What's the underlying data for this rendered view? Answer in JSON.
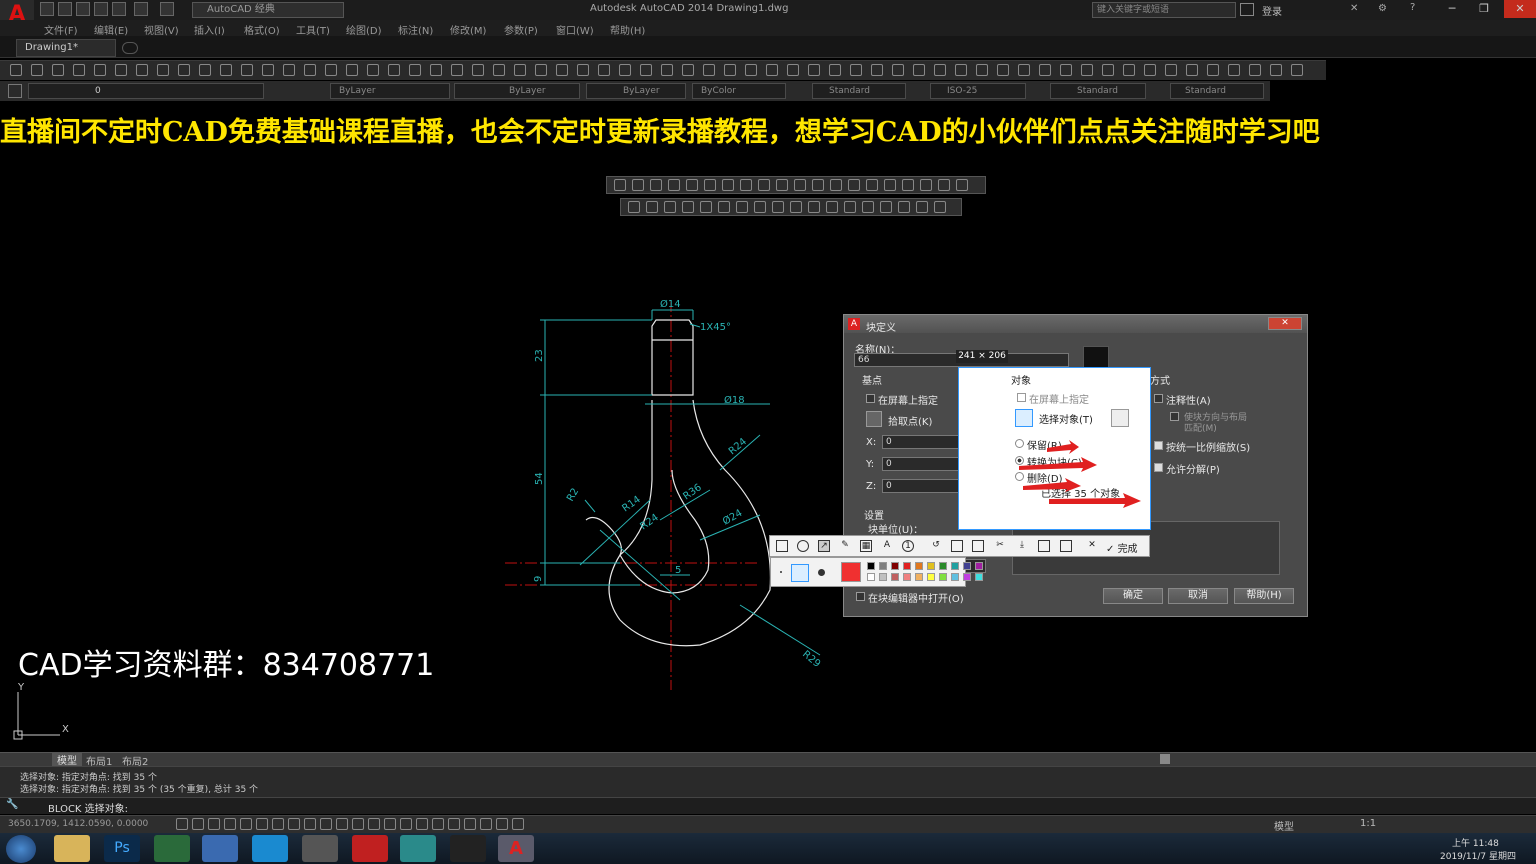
{
  "app": {
    "title": "Autodesk AutoCAD 2014    Drawing1.dwg",
    "workspace": "AutoCAD 经典",
    "search_placeholder": "键入关键字或短语",
    "login": "登录",
    "logo": "A"
  },
  "menu": [
    "文件(F)",
    "编辑(E)",
    "视图(V)",
    "插入(I)",
    "格式(O)",
    "工具(T)",
    "绘图(D)",
    "标注(N)",
    "修改(M)",
    "参数(P)",
    "窗口(W)",
    "帮助(H)"
  ],
  "doc_tab": "Drawing1*",
  "toolbar2": {
    "layer": "0",
    "color": "ByLayer",
    "linetype": "ByLayer",
    "lineweight": "ByLayer",
    "plotstyle": "ByColor",
    "text_style": "Standard",
    "dim_style": "ISO-25",
    "table_style": "Standard",
    "mleader_style": "Standard"
  },
  "banner": "直播间不定时CAD免费基础课程直播，也会不定时更新录播教程，想学习CAD的小伙伴们点点关注随时学习吧",
  "drawing": {
    "dims": [
      "Ø14",
      "1X45°",
      "23",
      "Ø18",
      "54",
      "R24",
      "R36",
      "R14",
      "R2",
      "R24",
      "Ø24",
      "5",
      "9",
      "R29"
    ]
  },
  "dialog": {
    "title": "块定义",
    "name_label": "名称(N)：",
    "name_value": "66",
    "basepoint_label": "基点",
    "specify_onscreen": "在屏幕上指定",
    "pick_point": "拾取点(K)",
    "x_label": "X:",
    "x_value": "0",
    "y_label": "Y:",
    "y_value": "0",
    "z_label": "Z:",
    "z_value": "0",
    "objects_label": "对象",
    "select_objects": "选择对象(T)",
    "retain": "保留(R)",
    "convert": "转换为块(C)",
    "delete": "删除(D)",
    "selected_count": "已选择 35 个对象",
    "behavior_label": "方式",
    "annotative": "注释性(A)",
    "match_orient": "使块方向与布局",
    "match_orient2": "匹配(M)",
    "scale_uniform": "按统一比例缩放(S)",
    "allow_explode": "允许分解(P)",
    "settings_label": "设置",
    "block_unit": "块单位(U)：",
    "description_label": "说明",
    "open_in_editor": "在块编辑器中打开(O)",
    "ok": "确定",
    "cancel": "取消",
    "help": "帮助(H)"
  },
  "snip": {
    "size": "241 × 206",
    "done": "完成"
  },
  "group_text": "CAD学习资料群：834708771",
  "layout_tabs": [
    "模型",
    "布局1",
    "布局2"
  ],
  "command": {
    "line1": "选择对象: 指定对角点: 找到 35 个",
    "line2": "选择对象: 指定对角点: 找到 35 个 (35 个重复), 总计 35 个",
    "prompt": "BLOCK 选择对象:"
  },
  "status": {
    "coords": "3650.1709, 1412.0590, 0.0000",
    "model": "模型",
    "scale": "1:1"
  },
  "clock": {
    "time": "上午 11:48",
    "date": "2019/11/7 星期四"
  },
  "colors": {
    "accent_red": "#e02020",
    "banner_yellow": "#ffe600",
    "drawing_cyan": "#2ab3b3",
    "drawing_white": "#e8e8e8",
    "centerline_red": "#c01010"
  }
}
